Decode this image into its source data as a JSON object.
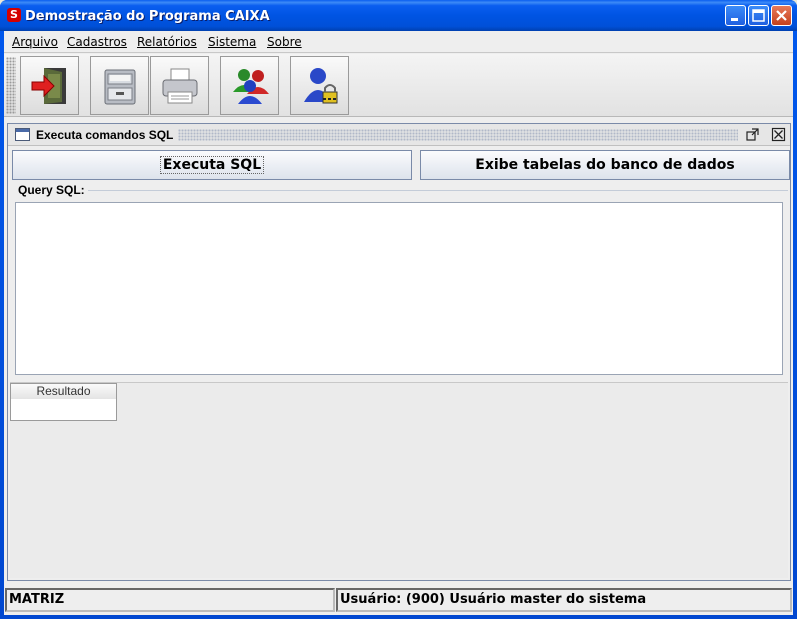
{
  "window": {
    "title": "Demostração do Programa CAIXA",
    "minimize": "_",
    "maximize": "□",
    "close": "✕",
    "app_icon": "S"
  },
  "menu": {
    "items": [
      "Arquivo",
      "Cadastros",
      "Relatórios",
      "Sistema",
      "Sobre"
    ]
  },
  "toolbar": {
    "icons": [
      "exit-door-icon",
      "file-cabinet-icon",
      "printer-icon",
      "users-group-icon",
      "user-lock-icon"
    ]
  },
  "internal_frame": {
    "title": "Executa comandos SQL",
    "execute_button": "Executa SQL",
    "show_tables_button": "Exibe tabelas do banco de dados",
    "query_label": "Query SQL:",
    "query_value": "",
    "result_column": "Resultado"
  },
  "status": {
    "branch": "MATRIZ",
    "user": "Usuário: (900) Usuário master do sistema"
  }
}
